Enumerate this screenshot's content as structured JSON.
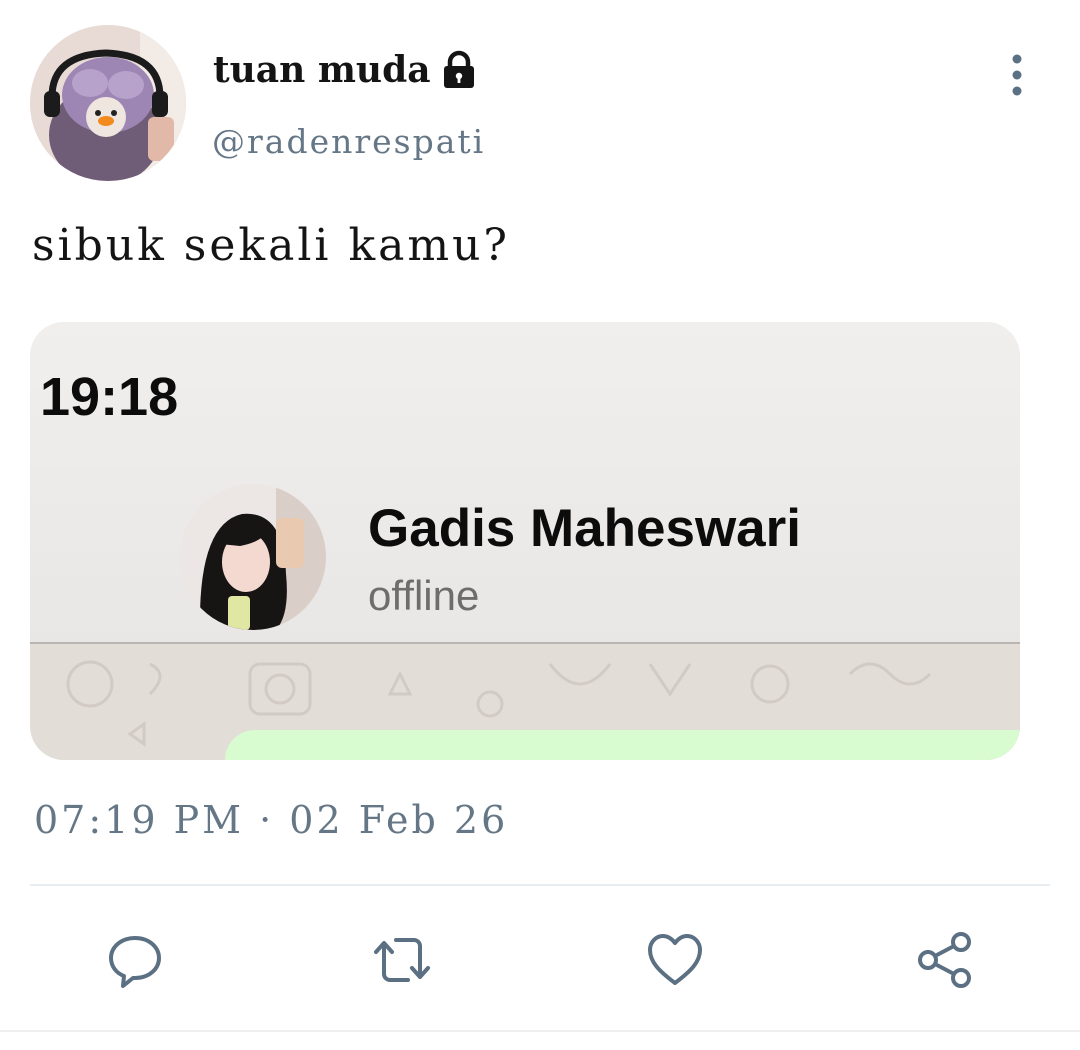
{
  "tweet": {
    "author": {
      "display_name": "tuan muda",
      "handle": "@radenrespati",
      "protected_icon": "lock-icon"
    },
    "text": "sibuk sekali kamu?",
    "timestamp": "07:19 PM · 02 Feb 26",
    "media": {
      "time": "19:18",
      "contact_name": "Gadis Maheswari",
      "contact_status": "offline"
    },
    "actions": [
      {
        "icon": "reply-icon"
      },
      {
        "icon": "retweet-icon"
      },
      {
        "icon": "like-icon"
      },
      {
        "icon": "share-icon"
      }
    ]
  },
  "colors": {
    "text": "#141414",
    "muted": "#657786",
    "icon": "#5b7083",
    "divider": "#e6ecf0",
    "bubble": "#d8fbcf"
  }
}
